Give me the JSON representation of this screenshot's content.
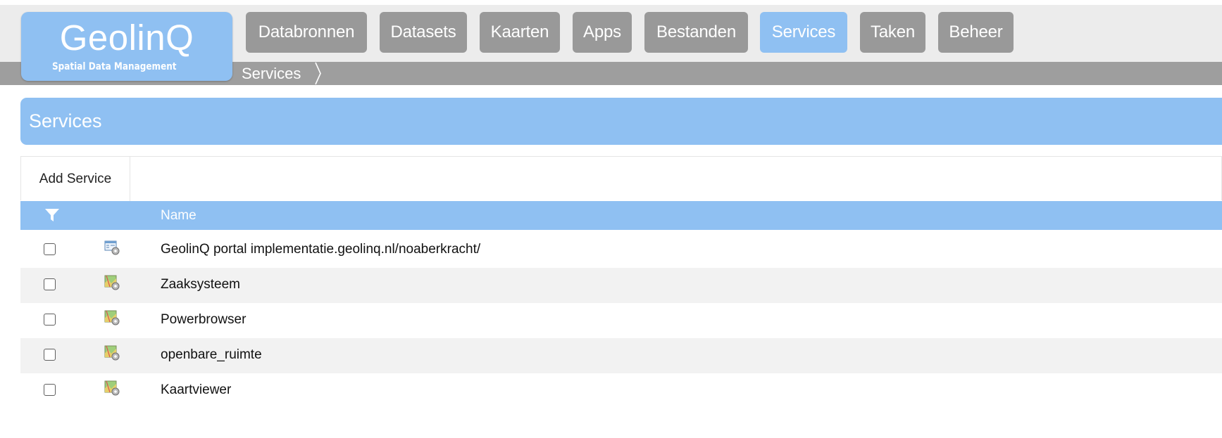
{
  "header": {
    "logo_title": "GeolinQ",
    "logo_subtitle": "Spatial Data Management",
    "nav": [
      {
        "label": "Databronnen",
        "active": false
      },
      {
        "label": "Datasets",
        "active": false
      },
      {
        "label": "Kaarten",
        "active": false
      },
      {
        "label": "Apps",
        "active": false
      },
      {
        "label": "Bestanden",
        "active": false
      },
      {
        "label": "Services",
        "active": true
      },
      {
        "label": "Taken",
        "active": false
      },
      {
        "label": "Beheer",
        "active": false
      }
    ],
    "breadcrumb": "Services"
  },
  "panel": {
    "title": "Services",
    "toolbar": {
      "add_label": "Add Service"
    },
    "columns": {
      "filter_icon": "filter-icon",
      "name": "Name"
    },
    "rows": [
      {
        "name": "GeolinQ portal implementatie.geolinq.nl/noaberkracht/",
        "icon": "portal-service-icon",
        "checked": false
      },
      {
        "name": "Zaaksysteem",
        "icon": "map-service-icon",
        "checked": false
      },
      {
        "name": "Powerbrowser",
        "icon": "map-service-icon",
        "checked": false
      },
      {
        "name": "openbare_ruimte",
        "icon": "map-service-icon",
        "checked": false
      },
      {
        "name": "Kaartviewer",
        "icon": "map-service-icon",
        "checked": false
      }
    ]
  },
  "colors": {
    "accent": "#8fc0f2",
    "nav_inactive": "#999999",
    "breadcrumb_bar": "#9e9e9e",
    "row_alt": "#f2f2f2"
  }
}
